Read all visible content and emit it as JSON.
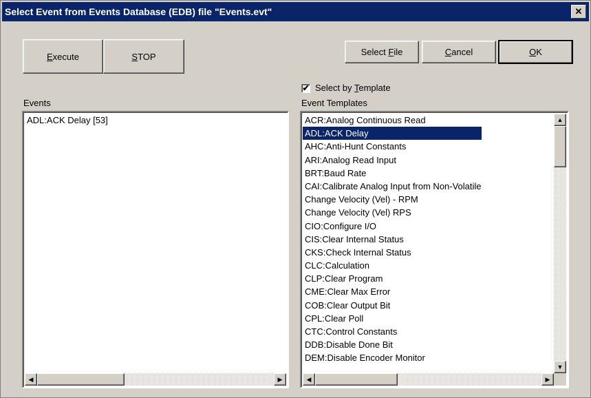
{
  "window": {
    "title": "Select Event from Events Database (EDB) file \"Events.evt\"",
    "close_glyph": "✕"
  },
  "toolbar": {
    "execute_label": "Execute",
    "stop_label": "STOP",
    "select_file_label": "Select File",
    "cancel_label": "Cancel",
    "ok_label": "OK"
  },
  "options": {
    "select_by_template_label": "Select by Template",
    "select_by_template_checked": true,
    "check_glyph": "✔"
  },
  "events": {
    "header": "Events",
    "items": [
      "ADL:ACK Delay [53]"
    ]
  },
  "templates": {
    "header": "Event Templates",
    "selected_index": 1,
    "items": [
      "ACR:Analog Continuous Read",
      "ADL:ACK Delay",
      "AHC:Anti-Hunt Constants",
      "ARI:Analog Read Input",
      "BRT:Baud Rate",
      "CAI:Calibrate Analog Input from Non-Volatile",
      "Change Velocity (Vel) - RPM",
      "Change Velocity (Vel) RPS",
      "CIO:Configure I/O",
      "CIS:Clear Internal Status",
      "CKS:Check Internal Status",
      "CLC:Calculation",
      "CLP:Clear Program",
      "CME:Clear Max Error",
      "COB:Clear Output Bit",
      "CPL:Clear Poll",
      "CTC:Control Constants",
      "DDB:Disable Done Bit",
      "DEM:Disable Encoder Monitor"
    ]
  },
  "scroll_glyphs": {
    "up": "▲",
    "down": "▼",
    "left": "◀",
    "right": "▶"
  }
}
